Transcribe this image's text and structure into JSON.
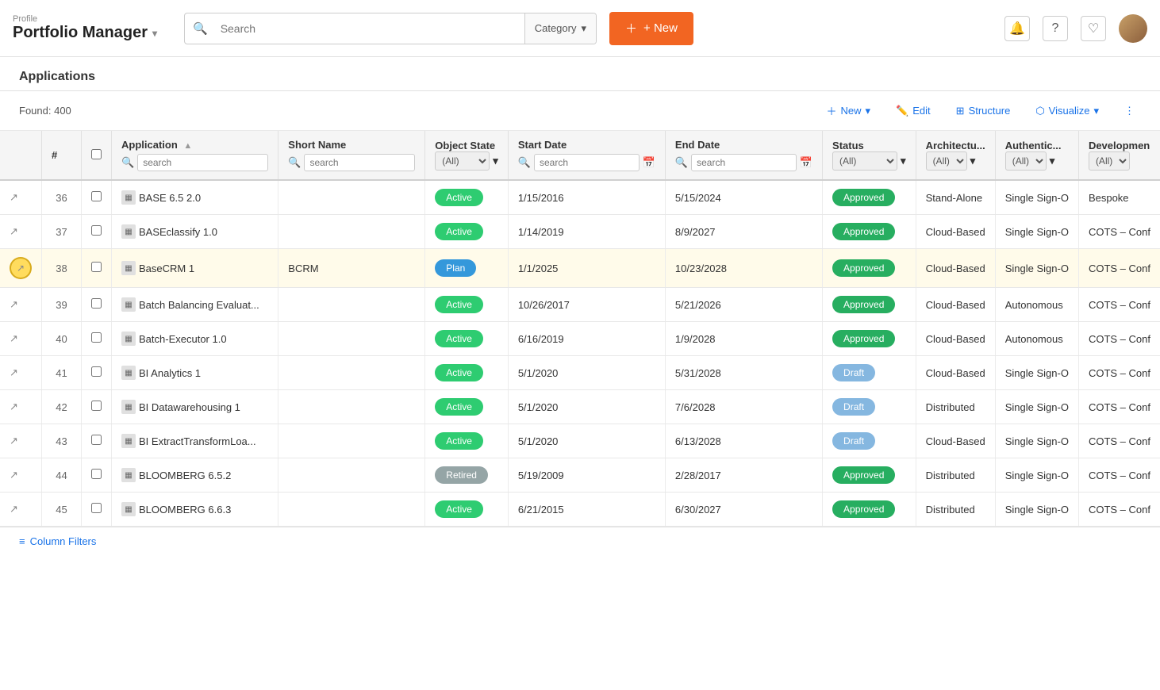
{
  "header": {
    "brand_sub": "Profile",
    "brand_title": "Portfolio Manager",
    "search_placeholder": "Search",
    "category_label": "Category",
    "new_button": "+ New"
  },
  "page": {
    "title": "Applications",
    "found_label": "Found: 400"
  },
  "toolbar": {
    "new_label": "New",
    "edit_label": "Edit",
    "structure_label": "Structure",
    "visualize_label": "Visualize"
  },
  "table": {
    "columns": [
      "#",
      "Application",
      "Short Name",
      "Object State",
      "Start Date",
      "End Date",
      "Status",
      "Architectu...",
      "Authentic...",
      "Developmen"
    ],
    "col_filters": {
      "object_state_options": [
        "(All)"
      ],
      "status_options": [
        "(All)"
      ],
      "arch_options": [
        "(All)"
      ],
      "auth_options": [
        "(All)"
      ],
      "dev_options": [
        "(All)"
      ]
    },
    "rows": [
      {
        "num": "36",
        "name": "BASE 6.5 2.0",
        "short_name": "",
        "object_state": "Active",
        "object_state_class": "badge-active",
        "start_date": "1/15/2016",
        "end_date": "5/15/2024",
        "status": "Approved",
        "status_class": "status-approved",
        "architecture": "Stand-Alone",
        "auth": "Single Sign-O",
        "dev": "Bespoke"
      },
      {
        "num": "37",
        "name": "BASEclassify 1.0",
        "short_name": "",
        "object_state": "Active",
        "object_state_class": "badge-active",
        "start_date": "1/14/2019",
        "end_date": "8/9/2027",
        "status": "Approved",
        "status_class": "status-approved",
        "architecture": "Cloud-Based",
        "auth": "Single Sign-O",
        "dev": "COTS – Conf"
      },
      {
        "num": "38",
        "name": "BaseCRM 1",
        "short_name": "BCRM",
        "object_state": "Plan",
        "object_state_class": "badge-plan",
        "start_date": "1/1/2025",
        "end_date": "10/23/2028",
        "status": "Approved",
        "status_class": "status-approved",
        "architecture": "Cloud-Based",
        "auth": "Single Sign-O",
        "dev": "COTS – Conf",
        "highlighted": true
      },
      {
        "num": "39",
        "name": "Batch Balancing Evaluat...",
        "short_name": "",
        "object_state": "Active",
        "object_state_class": "badge-active",
        "start_date": "10/26/2017",
        "end_date": "5/21/2026",
        "status": "Approved",
        "status_class": "status-approved",
        "architecture": "Cloud-Based",
        "auth": "Autonomous",
        "dev": "COTS – Conf"
      },
      {
        "num": "40",
        "name": "Batch-Executor 1.0",
        "short_name": "",
        "object_state": "Active",
        "object_state_class": "badge-active",
        "start_date": "6/16/2019",
        "end_date": "1/9/2028",
        "status": "Approved",
        "status_class": "status-approved",
        "architecture": "Cloud-Based",
        "auth": "Autonomous",
        "dev": "COTS – Conf"
      },
      {
        "num": "41",
        "name": "BI Analytics 1",
        "short_name": "",
        "object_state": "Active",
        "object_state_class": "badge-active",
        "start_date": "5/1/2020",
        "end_date": "5/31/2028",
        "status": "Draft",
        "status_class": "status-draft",
        "architecture": "Cloud-Based",
        "auth": "Single Sign-O",
        "dev": "COTS – Conf"
      },
      {
        "num": "42",
        "name": "BI Datawarehousing 1",
        "short_name": "",
        "object_state": "Active",
        "object_state_class": "badge-active",
        "start_date": "5/1/2020",
        "end_date": "7/6/2028",
        "status": "Draft",
        "status_class": "status-draft",
        "architecture": "Distributed",
        "auth": "Single Sign-O",
        "dev": "COTS – Conf"
      },
      {
        "num": "43",
        "name": "BI ExtractTransformLoa...",
        "short_name": "",
        "object_state": "Active",
        "object_state_class": "badge-active",
        "start_date": "5/1/2020",
        "end_date": "6/13/2028",
        "status": "Draft",
        "status_class": "status-draft",
        "architecture": "Cloud-Based",
        "auth": "Single Sign-O",
        "dev": "COTS – Conf"
      },
      {
        "num": "44",
        "name": "BLOOMBERG 6.5.2",
        "short_name": "",
        "object_state": "Retired",
        "object_state_class": "badge-retired",
        "start_date": "5/19/2009",
        "end_date": "2/28/2017",
        "status": "Approved",
        "status_class": "status-approved",
        "architecture": "Distributed",
        "auth": "Single Sign-O",
        "dev": "COTS – Conf"
      },
      {
        "num": "45",
        "name": "BLOOMBERG 6.6.3",
        "short_name": "",
        "object_state": "Active",
        "object_state_class": "badge-active",
        "start_date": "6/21/2015",
        "end_date": "6/30/2027",
        "status": "Approved",
        "status_class": "status-approved",
        "architecture": "Distributed",
        "auth": "Single Sign-O",
        "dev": "COTS – Conf"
      }
    ]
  },
  "footer": {
    "column_filters": "Column Filters"
  }
}
